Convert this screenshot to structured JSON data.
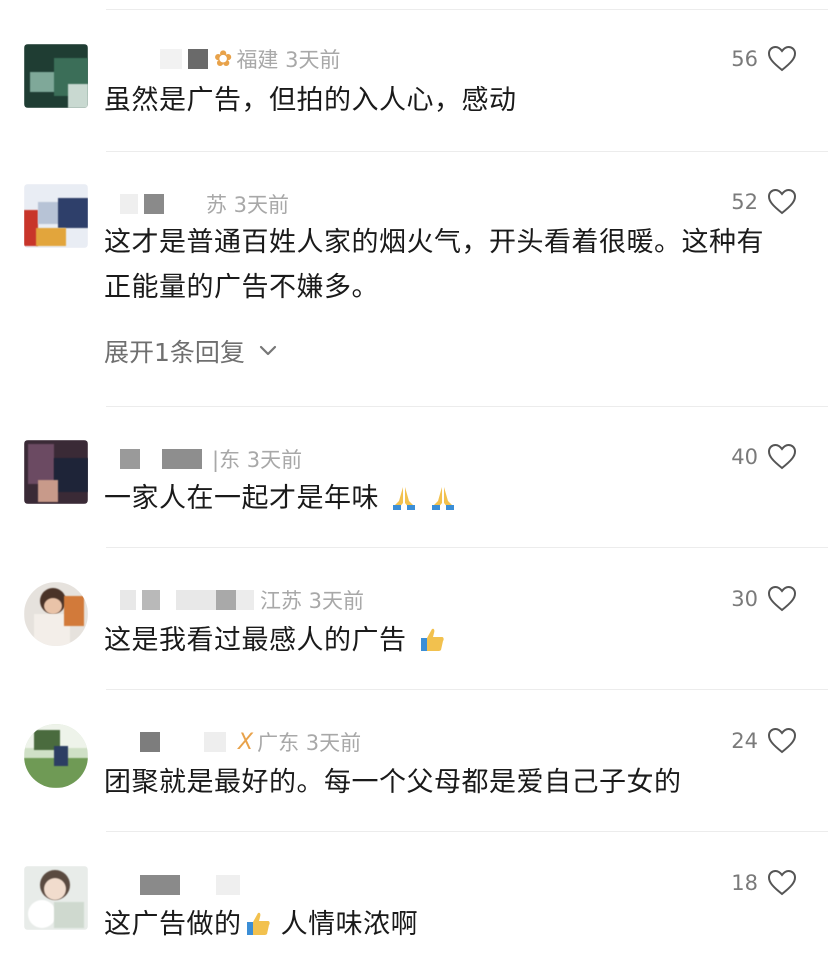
{
  "comments": [
    {
      "region_time": "福建 3天前",
      "likes": "56",
      "text": "虽然是广告，但拍的入人心，感动"
    },
    {
      "region_time": "苏 3天前",
      "likes": "52",
      "text": "这才是普通百姓人家的烟火气，开头看着很暖。这种有正能量的广告不嫌多。",
      "expand": "展开1条回复"
    },
    {
      "region_time": "|东 3天前",
      "likes": "40",
      "text": "一家人在一起才是年味",
      "emojis": [
        "folded-hands",
        "folded-hands"
      ]
    },
    {
      "region_time": "江苏 3天前",
      "likes": "30",
      "text": "这是我看过最感人的广告",
      "emojis": [
        "thumbs-up"
      ]
    },
    {
      "region_time": "广东 3天前",
      "likes": "24",
      "text": "团聚就是最好的。每一个父母都是爱自己子女的",
      "name_suffix": "X"
    },
    {
      "region_time": "",
      "likes": "18",
      "text_before": "这广告做的",
      "text_after": " 人情味浓啊",
      "emojis": [
        "thumbs-up"
      ]
    }
  ],
  "colors": {
    "divider": "#ececec",
    "meta": "#a8a8a8",
    "like_count": "#7a7a7a",
    "text": "#1a1a1a"
  },
  "icons": {
    "like": "heart-outline-icon",
    "expand": "chevron-down-icon"
  }
}
